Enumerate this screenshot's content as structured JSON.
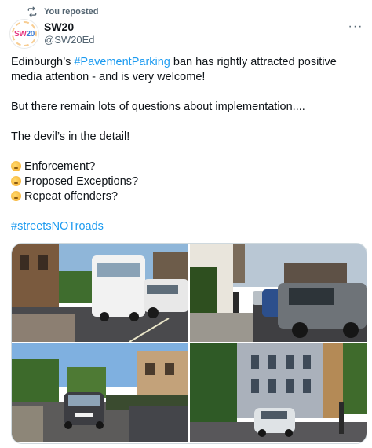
{
  "repost": {
    "label": "You reposted",
    "icon": "repost-icon"
  },
  "author": {
    "display_name": "SW20",
    "handle": "@SW20Ed",
    "avatar": {
      "text_part1": "SW",
      "text_part2": "20"
    }
  },
  "more_label": "···",
  "tweet": {
    "p1_before": "Edinburgh’s ",
    "p1_hashtag": "#PavementParking",
    "p1_after": " ban has rightly attracted positive media attention - and is very welcome!",
    "p2": "But there remain lots of questions about implementation....",
    "p3": "The devil’s in the detail!",
    "questions": [
      "Enforcement?",
      "Proposed Exceptions?",
      "Repeat offenders?"
    ],
    "question_icon": "thinking-face-icon",
    "hashtag": "#streetsNOTroads"
  },
  "media": [
    {
      "icon": "photo-van-on-pavement"
    },
    {
      "icon": "photo-cars-parked-on-pavement"
    },
    {
      "icon": "photo-car-on-street"
    },
    {
      "icon": "photo-car-by-tenement"
    }
  ],
  "colors": {
    "link": "#1d9bf0",
    "muted": "#536471",
    "text": "#0f1419"
  }
}
